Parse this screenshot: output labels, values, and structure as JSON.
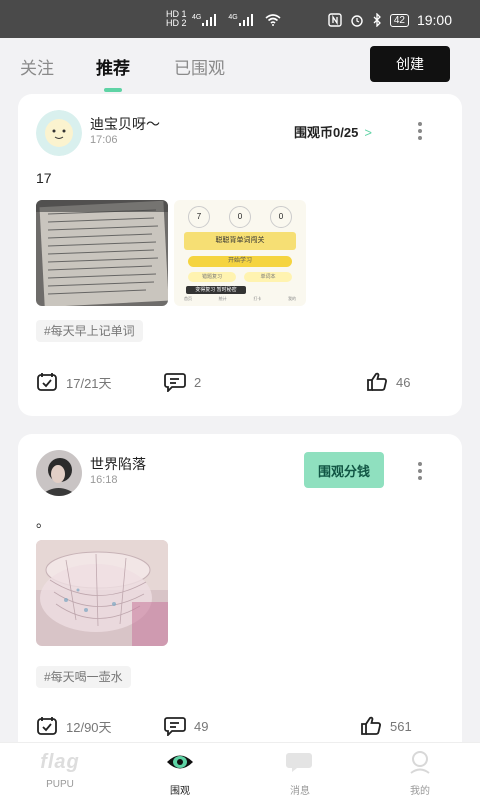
{
  "status_bar": {
    "hd_top": "HD 1",
    "hd_bottom": "HD 2",
    "signal_1": "4G",
    "signal_2": "4G",
    "battery": "42",
    "time": "19:00"
  },
  "tabs": [
    {
      "label": "关注",
      "active": false
    },
    {
      "label": "推荐",
      "active": true
    },
    {
      "label": "已围观",
      "active": false
    }
  ],
  "create_button": "创建",
  "posts": [
    {
      "username": "迪宝贝呀～",
      "time": "17:06",
      "coin_label": "围观币0/25",
      "coin_arrow": ">",
      "text": "17",
      "tag": "#每天早上记单词",
      "progress": "17/21天",
      "comments": "2",
      "likes": "46",
      "images": [
        {
          "kind": "notebook-photo"
        },
        {
          "kind": "app-screenshot",
          "stats": [
            "7",
            "0",
            "0"
          ],
          "banner": "聪聪背单词闯关",
          "buttons": [
            "开始学习",
            "错题复习",
            "单词本"
          ],
          "popup": "变得复习 暂时秘密",
          "nav": [
            "首页",
            "统计",
            "打卡",
            "我的"
          ]
        }
      ]
    },
    {
      "username": "世界陷落",
      "time": "16:18",
      "share_button": "围观分钱",
      "text": "。",
      "tag": "#每天喝一壶水",
      "progress": "12/90天",
      "comments": "49",
      "likes": "561",
      "images": [
        {
          "kind": "glass-photo"
        }
      ]
    }
  ],
  "bottom_nav": [
    {
      "label": "PUPU",
      "logo": "flag",
      "icon": "flag-logo",
      "active": false
    },
    {
      "label": "围观",
      "icon": "eye-icon",
      "active": true
    },
    {
      "label": "消息",
      "icon": "chat-bubble-icon",
      "active": false
    },
    {
      "label": "我的",
      "icon": "person-icon",
      "active": false
    }
  ],
  "colors": {
    "accent": "#5fd3a5",
    "share_button": "#8fe0bf",
    "create_button": "#111111",
    "status_bar": "#4a4a4a"
  }
}
